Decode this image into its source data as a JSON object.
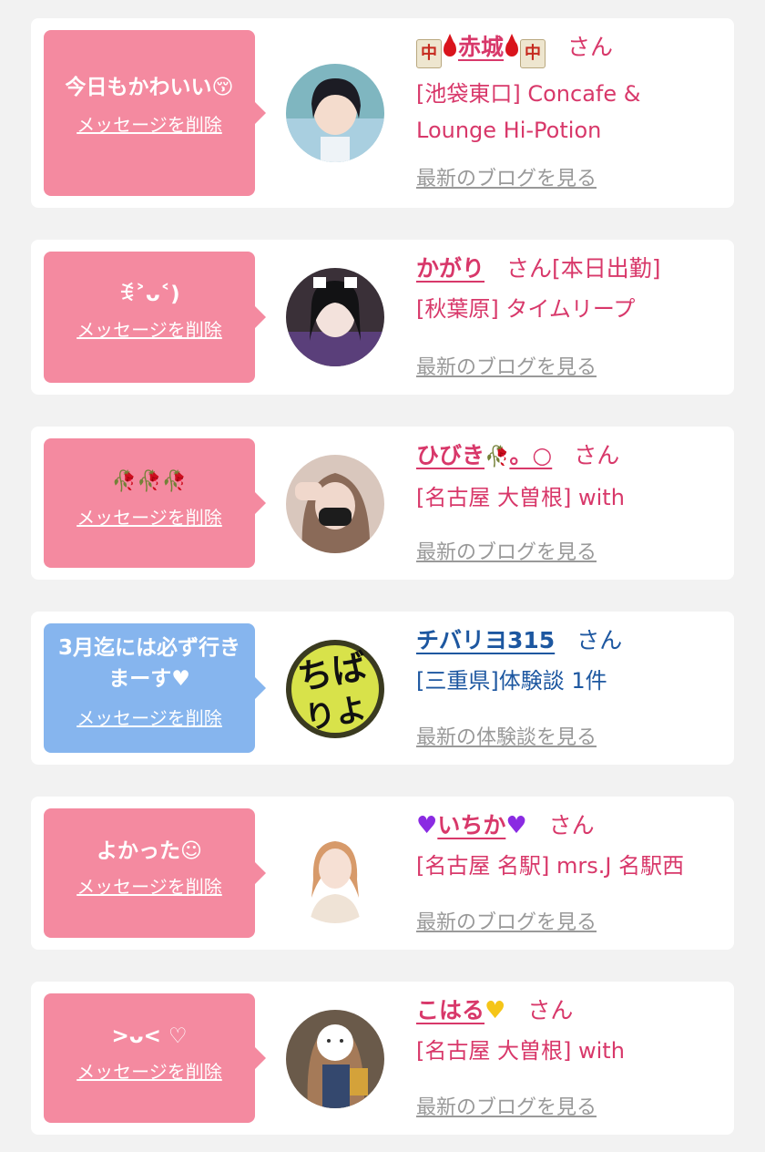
{
  "delete_label": "メッセージを削除",
  "san_label": "さん",
  "blog_link": "最新のブログを見る",
  "review_link": "最新の体験談を見る",
  "cards": [
    {
      "message": "今日もかわいい😚",
      "name": "赤城",
      "name_suffix": "",
      "shop": "[池袋東口] Concafe & Lounge Hi-Potion"
    },
    {
      "message": "ꉂ˃ᴗ˂)",
      "name": "かがり",
      "after_san": "[本日出勤]",
      "shop": "[秋葉原] タイムリープ"
    },
    {
      "message": "🥀🥀🥀",
      "name": "ひびき",
      "name_suffix": "。○",
      "shop": "[名古屋 大曽根] with"
    },
    {
      "message": "3月迄には必ず行きまーす♥",
      "name": "チバリヨ315",
      "shop": "[三重県]体験談 1件"
    },
    {
      "message": "よかった☺",
      "name": "いちか",
      "shop": "[名古屋 名駅] mrs.J 名駅西"
    },
    {
      "message": ">ᴗ< ♡",
      "name": "こはる",
      "shop": "[名古屋 大曽根] with"
    }
  ],
  "colors": {
    "pink_bubble": "#f48aa0",
    "blue_bubble": "#86b5ee",
    "pink_text": "#d8386a",
    "blue_text": "#1d57a0",
    "link_gray": "#999999"
  }
}
